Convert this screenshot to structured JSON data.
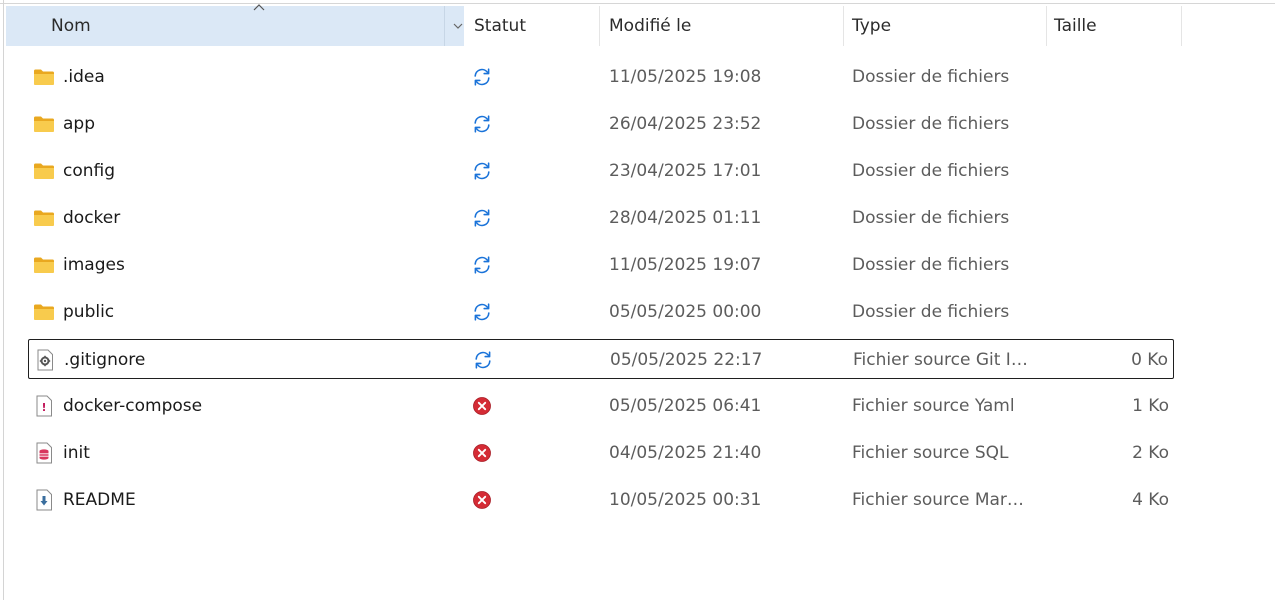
{
  "columns": {
    "name": "Nom",
    "status": "Statut",
    "modified": "Modifié le",
    "type": "Type",
    "size": "Taille"
  },
  "colors": {
    "header_selected": "#dbe8f6",
    "sync_icon": "#1a73d9",
    "error_icon": "#d42b35",
    "folder": "#f6c343"
  },
  "files": [
    {
      "name": ".idea",
      "icon": "folder-icon",
      "status": "sync-icon",
      "modified": "11/05/2025 19:08",
      "type": "Dossier de fichiers",
      "size": ""
    },
    {
      "name": "app",
      "icon": "folder-icon",
      "status": "sync-icon",
      "modified": "26/04/2025 23:52",
      "type": "Dossier de fichiers",
      "size": ""
    },
    {
      "name": "config",
      "icon": "folder-icon",
      "status": "sync-icon",
      "modified": "23/04/2025 17:01",
      "type": "Dossier de fichiers",
      "size": ""
    },
    {
      "name": "docker",
      "icon": "folder-icon",
      "status": "sync-icon",
      "modified": "28/04/2025 01:11",
      "type": "Dossier de fichiers",
      "size": ""
    },
    {
      "name": "images",
      "icon": "folder-icon",
      "status": "sync-icon",
      "modified": "11/05/2025 19:07",
      "type": "Dossier de fichiers",
      "size": ""
    },
    {
      "name": "public",
      "icon": "folder-icon",
      "status": "sync-icon",
      "modified": "05/05/2025 00:00",
      "type": "Dossier de fichiers",
      "size": ""
    },
    {
      "name": ".gitignore",
      "icon": "gear-file-icon",
      "status": "sync-icon",
      "modified": "05/05/2025 22:17",
      "type": "Fichier source Git Ign...",
      "size": "0 Ko"
    },
    {
      "name": "docker-compose",
      "icon": "yaml-file-icon",
      "status": "error-icon",
      "modified": "05/05/2025 06:41",
      "type": "Fichier source Yaml",
      "size": "1 Ko"
    },
    {
      "name": "init",
      "icon": "sql-file-icon",
      "status": "error-icon",
      "modified": "04/05/2025 21:40",
      "type": "Fichier source SQL",
      "size": "2 Ko"
    },
    {
      "name": "README",
      "icon": "markdown-file-icon",
      "status": "error-icon",
      "modified": "10/05/2025 00:31",
      "type": "Fichier source Markd...",
      "size": "4 Ko"
    }
  ]
}
